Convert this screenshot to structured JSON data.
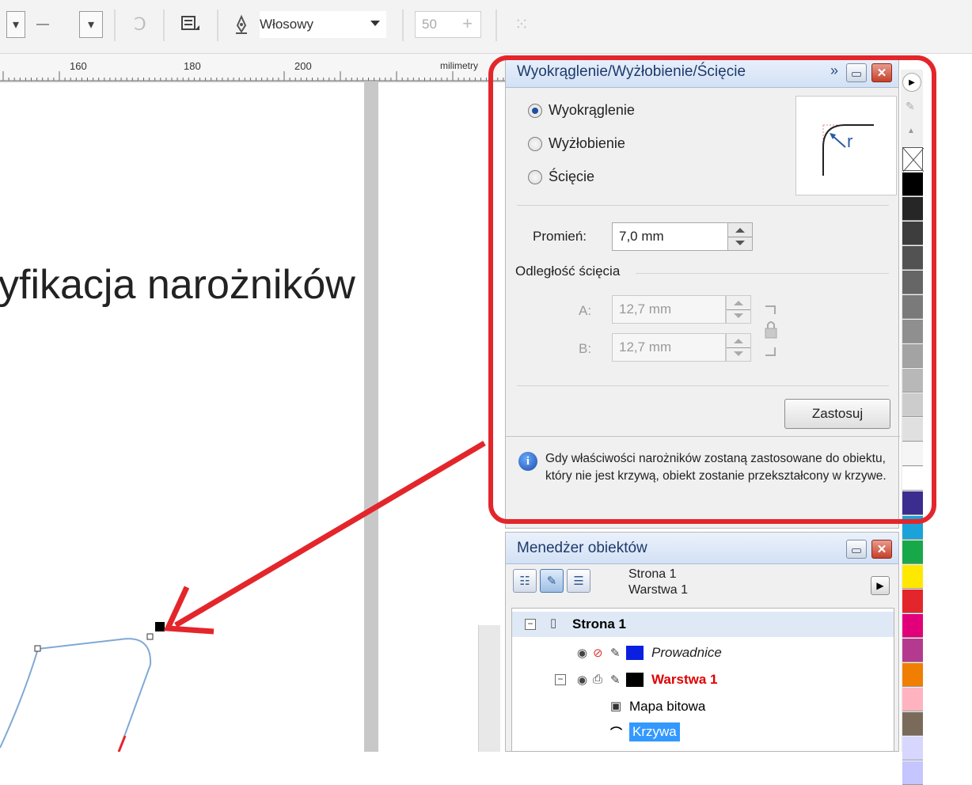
{
  "toolbar": {
    "line_style_glyph": "—",
    "outline_width": "Włosowy",
    "zoom_value": "50"
  },
  "ruler": {
    "labels": [
      "160",
      "180",
      "200"
    ],
    "unit": "milimetry"
  },
  "canvas": {
    "heading_fragment": "yfikacja narożników"
  },
  "fillet_docker": {
    "title": "Wyokrąglenie/Wyżłobienie/Ścięcie",
    "modes": [
      "Wyokrąglenie",
      "Wyżłobienie",
      "Ścięcie"
    ],
    "selected_mode": "Wyokrąglenie",
    "preview_letter": "r",
    "radius_label": "Promień:",
    "radius_value": "7,0 mm",
    "chamfer_group_label": "Odległość ścięcia",
    "a_label": "A:",
    "a_value": "12,7 mm",
    "b_label": "B:",
    "b_value": "12,7 mm",
    "apply_label": "Zastosuj",
    "info_text": "Gdy właściwości narożników zostaną zastosowane do obiektu, który nie jest krzywą, obiekt zostanie przekształcony w krzywe."
  },
  "object_manager": {
    "title": "Menedżer obiektów",
    "page_line": "Strona 1",
    "layer_line": "Warstwa 1",
    "tree": [
      {
        "label": "Strona 1",
        "style": "bold"
      },
      {
        "label": "Prowadnice",
        "style": "italic",
        "color": "#0a1fe0"
      },
      {
        "label": "Warstwa 1",
        "style": "bold",
        "color": "#e00000"
      },
      {
        "label": "Mapa bitowa",
        "style": "normal"
      },
      {
        "label": "Krzywa",
        "style": "selected"
      }
    ]
  },
  "colors": {
    "highlight": "#e3262b",
    "palette": [
      "#000000",
      "#262626",
      "#3d3d3d",
      "#525252",
      "#666666",
      "#7a7a7a",
      "#8f8f8f",
      "#a3a3a3",
      "#b8b8b8",
      "#cccccc",
      "#e0e0e0",
      "#f5f5f5",
      "#ffffff",
      "#3b2d8f",
      "#1aa3d9",
      "#17a84a",
      "#ffe800",
      "#e3262b",
      "#e2007a",
      "#b43a8f",
      "#f07e00",
      "#ffb3c0",
      "#7a6a5a",
      "#d6d6ff",
      "#c5c5ff"
    ]
  }
}
